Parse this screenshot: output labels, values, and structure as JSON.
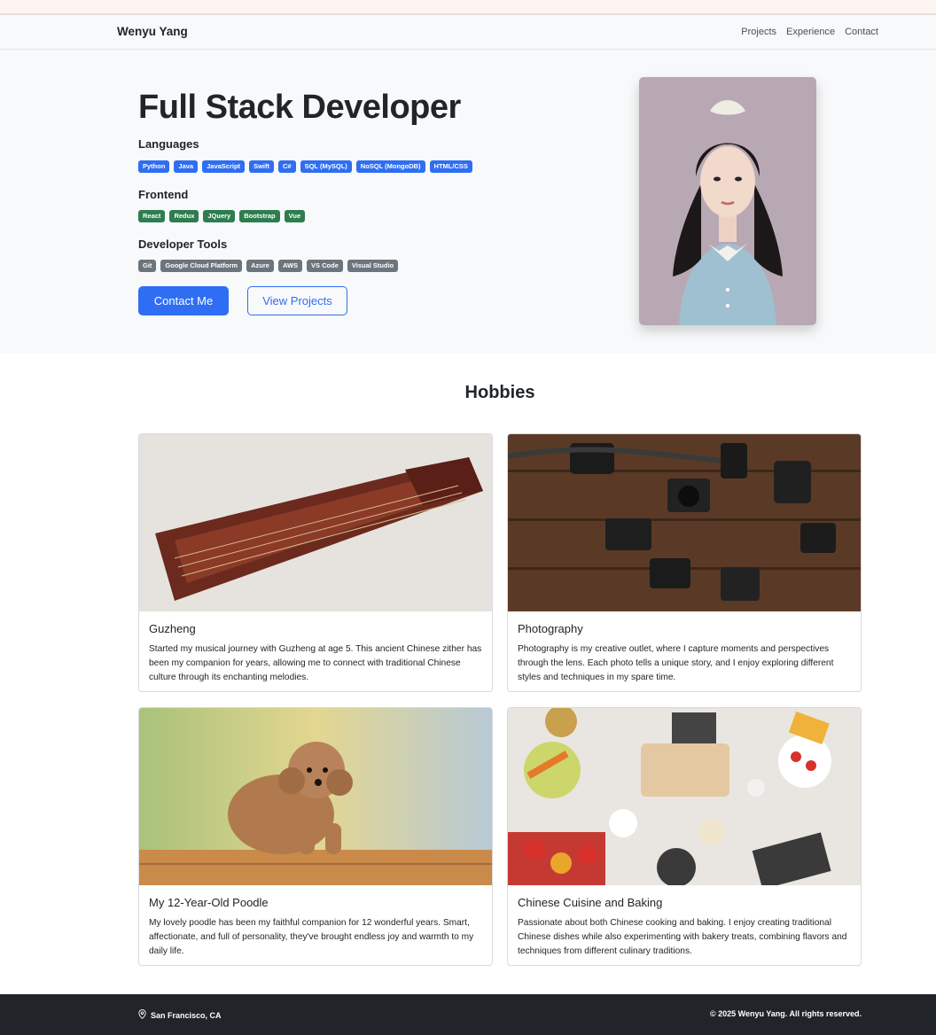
{
  "navbar": {
    "brand": "Wenyu Yang",
    "links": [
      "Projects",
      "Experience",
      "Contact"
    ]
  },
  "hero": {
    "title": "Full Stack Developer",
    "languages_heading": "Languages",
    "languages": [
      "Python",
      "Java",
      "JavaScript",
      "Swift",
      "C#",
      "SQL (MySQL)",
      "NoSQL (MongoDB)",
      "HTML/CSS"
    ],
    "frontend_heading": "Frontend",
    "frontend": [
      "React",
      "Redux",
      "JQuery",
      "Bootstrap",
      "Vue"
    ],
    "tools_heading": "Developer Tools",
    "tools": [
      "Git",
      "Google Cloud Platform",
      "Azure",
      "AWS",
      "VS Code",
      "Visual Studio"
    ],
    "contact_button": "Contact Me",
    "projects_button": "View Projects"
  },
  "hobbies": {
    "heading": "Hobbies",
    "cards": [
      {
        "title": "Guzheng",
        "text": "Started my musical journey with Guzheng at age 5. This ancient Chinese zither has been my companion for years, allowing me to connect with traditional Chinese culture through its enchanting melodies."
      },
      {
        "title": "Photography",
        "text": "Photography is my creative outlet, where I capture moments and perspectives through the lens. Each photo tells a unique story, and I enjoy exploring different styles and techniques in my spare time."
      },
      {
        "title": "My 12-Year-Old Poodle",
        "text": "My lovely poodle has been my faithful companion for 12 wonderful years. Smart, affectionate, and full of personality, they've brought endless joy and warmth to my daily life."
      },
      {
        "title": "Chinese Cuisine and Baking",
        "text": "Passionate about both Chinese cooking and baking. I enjoy creating traditional Chinese dishes while also experimenting with bakery treats, combining flavors and techniques from different culinary traditions."
      }
    ]
  },
  "footer": {
    "location": "San Francisco, CA",
    "copyright": "© 2025 Wenyu Yang. All rights reserved."
  },
  "colors": {
    "primary": "#2f6ef2",
    "frontend_badge": "#2e7d4f",
    "tools_badge": "#6c757d",
    "footer_bg": "#212529",
    "hero_bg": "#f8f9fa"
  },
  "icons": {
    "location": "map-pin-icon"
  }
}
